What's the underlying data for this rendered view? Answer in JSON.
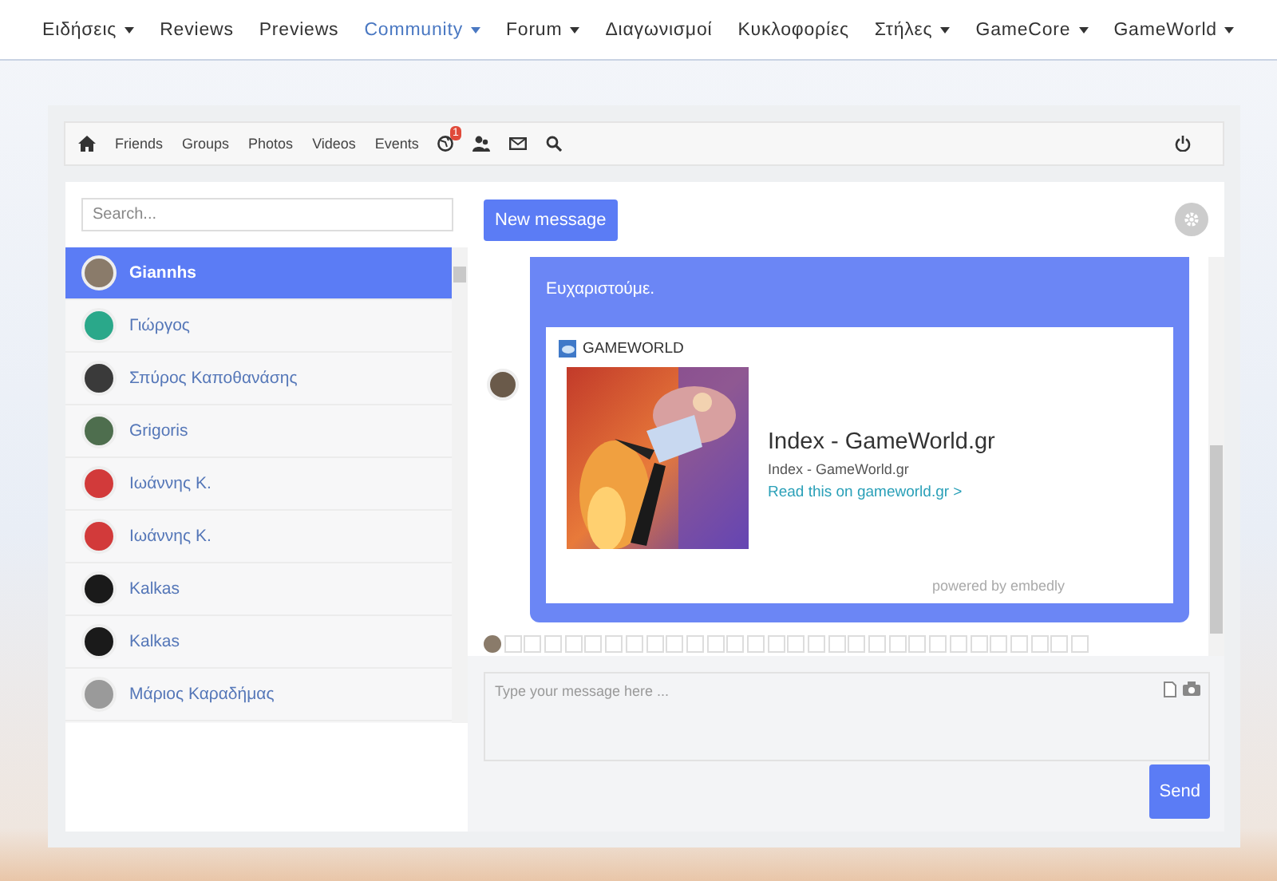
{
  "nav": [
    {
      "label": "Ειδήσεις",
      "dropdown": true,
      "selected": false
    },
    {
      "label": "Reviews",
      "dropdown": false,
      "selected": false
    },
    {
      "label": "Previews",
      "dropdown": false,
      "selected": false
    },
    {
      "label": "Community",
      "dropdown": true,
      "selected": true
    },
    {
      "label": "Forum",
      "dropdown": true,
      "selected": false
    },
    {
      "label": "Διαγωνισμοί",
      "dropdown": false,
      "selected": false
    },
    {
      "label": "Κυκλοφορίες",
      "dropdown": false,
      "selected": false
    },
    {
      "label": "Στήλες",
      "dropdown": true,
      "selected": false
    },
    {
      "label": "GameCore",
      "dropdown": true,
      "selected": false
    },
    {
      "label": "GameWorld",
      "dropdown": true,
      "selected": false
    }
  ],
  "toolbar": {
    "links": [
      "Friends",
      "Groups",
      "Photos",
      "Videos",
      "Events"
    ],
    "notification_badge": "1"
  },
  "contacts": {
    "search_placeholder": "Search...",
    "items": [
      {
        "name": "Giannhs",
        "selected": true,
        "color": "#8a7b6a"
      },
      {
        "name": "Γιώργος",
        "selected": false,
        "color": "#2aa88a"
      },
      {
        "name": "Σπύρος Καποθανάσης",
        "selected": false,
        "color": "#3a3a3a"
      },
      {
        "name": "Grigoris",
        "selected": false,
        "color": "#4e6e4e"
      },
      {
        "name": "Ιωάννης Κ.",
        "selected": false,
        "color": "#d23a3a"
      },
      {
        "name": "Ιωάννης Κ.",
        "selected": false,
        "color": "#d23a3a"
      },
      {
        "name": "Kalkas",
        "selected": false,
        "color": "#1a1a1a"
      },
      {
        "name": "Kalkas",
        "selected": false,
        "color": "#1a1a1a"
      },
      {
        "name": "Μάριος Καραδήμας",
        "selected": false,
        "color": "#9a9a9a"
      }
    ]
  },
  "chat": {
    "new_message": "New message",
    "message": "Ευχαριστούμε.",
    "embed": {
      "site": "GAMEWORLD",
      "title": "Index - GameWorld.gr",
      "description": "Index - GameWorld.gr",
      "link": "Read this on gameworld.gr >",
      "footer": "powered by embedly"
    },
    "input_placeholder": "Type your message here ...",
    "send": "Send"
  }
}
